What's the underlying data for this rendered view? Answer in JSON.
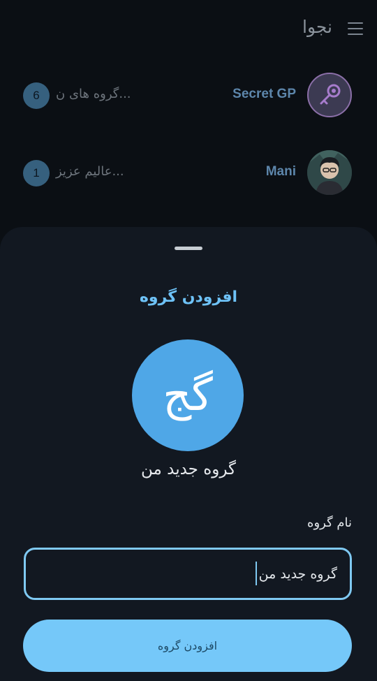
{
  "app": {
    "title": "نجوا"
  },
  "chats": [
    {
      "name": "Secret GP",
      "preview": "...گروه های ن",
      "unread": "6",
      "avatar_icon": "key-icon"
    },
    {
      "name": "Mani",
      "preview": "...عالیم عزیز",
      "unread": "1",
      "avatar_icon": "user-photo"
    }
  ],
  "sheet": {
    "title": "افزودن گروه",
    "avatar_initials": "گج",
    "group_name_preview": "گروه جدید من",
    "field_label": "نام گروه",
    "input_value": "گروه جدید من",
    "submit_label": "افزودن گروه"
  },
  "colors": {
    "accent": "#6ec2f7",
    "avatar_bg": "#4fa7e7",
    "button_bg": "#75c8f9",
    "sheet_bg": "#121821",
    "page_bg": "#0b0f14"
  }
}
